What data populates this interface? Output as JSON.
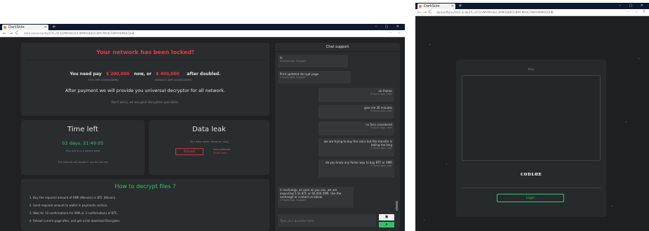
{
  "left_browser": {
    "tab_title": "DarkSide",
    "new_tab": "+",
    "window_controls": "– ▢ ✕",
    "nav": {
      "back": "←",
      "forward": "→",
      "reload": "C"
    },
    "url": "dark.onion/contact/?t=OCD3MYA9GIGC4M90QBE0CBMCMX4CFBNYABMDEDHB",
    "toolbar_icons": "⋯ ☆",
    "ransom": {
      "title": "Your network has been locked!",
      "you_need_pay": "You need pay",
      "amount_now": "$ 200,000",
      "now_or": "now, or",
      "amount_later": "$ 400,000",
      "after_doubled": "after doubled.",
      "sub_now": "7500 XMR  (200000/XMR)",
      "sub_later": "15000000 XMR (400000/XMR)",
      "promise": "After payment we will provide you universal decryptor for all network.",
      "specialists": "Don't worry, we are good decryption specialists."
    },
    "time_left": {
      "title": "Time left",
      "countdown": "02 days, 21:49:05",
      "note1": "Your link is in a secure zone",
      "note2": "The amount will double if you do not pay"
    },
    "data_leak": {
      "title": "Data leak",
      "desc": "Your data stolen. Read our blog",
      "button": "Proceed",
      "not_published": "Not published",
      "show_more": "Show more"
    },
    "how_to": {
      "title": "How to decrypt files ?",
      "steps": [
        "1. Buy the required amount of XMR (Monero) or BTC (Bitcoin).",
        "2. Send required amount to wallet in payments section.",
        "3. Wait for 10 confirmations for XMR or 3 confirmations of BTC.",
        "4. Reload current page after, and get a link download Decryptor."
      ]
    },
    "chat": {
      "title": "Chat support",
      "messages": [
        {
          "side": "left",
          "text": "hi",
          "time": "5 hours ago, Support"
        },
        {
          "side": "left",
          "text": "Print updated decrypt page",
          "time": "5 hours ago, Support"
        },
        {
          "side": "right",
          "text": "ok thanks",
          "time": "5 hours ago, User"
        },
        {
          "side": "right",
          "text": "give me 30 minutes",
          "time": "5 hours ago, User"
        },
        {
          "side": "right",
          "text": "no fees considered",
          "time": "5 hours ago, User"
        },
        {
          "side": "right",
          "text": "we are trying to buy the coins but the transfer is taking too long",
          "time": "5 hours ago, User"
        },
        {
          "side": "right",
          "text": "do you know any faster way to buy BTC or XMR",
          "time": "5 hours ago, User"
        },
        {
          "side": "left",
          "text": "in exchange, as soon as you can, we are expecting 5.5k BTC or 60,000 XMR. Use the exchange or contact us below.",
          "time": "2 hours ago, Support"
        }
      ],
      "input_placeholder": "Type your question here",
      "attach_icon": "▣",
      "send_icon": "➤"
    }
  },
  "right_browser": {
    "tab_title": "DarkSide",
    "new_tab": "+",
    "window_controls": "– ▢ ✕",
    "nav": {
      "back": "←",
      "forward": "→",
      "reload": "C"
    },
    "url": "darksidfqzcuhtk2.onion/?t=OCD3MYA9GIGC4M90QBE0CBMCMX4CFBNYABMDEDHB",
    "toolbar_icons": "⋯ ☆ ⫴",
    "login": {
      "key_label": "Key",
      "captcha_text": "ᴄᴏᴅʟɑᴇ",
      "button": "Login"
    }
  }
}
